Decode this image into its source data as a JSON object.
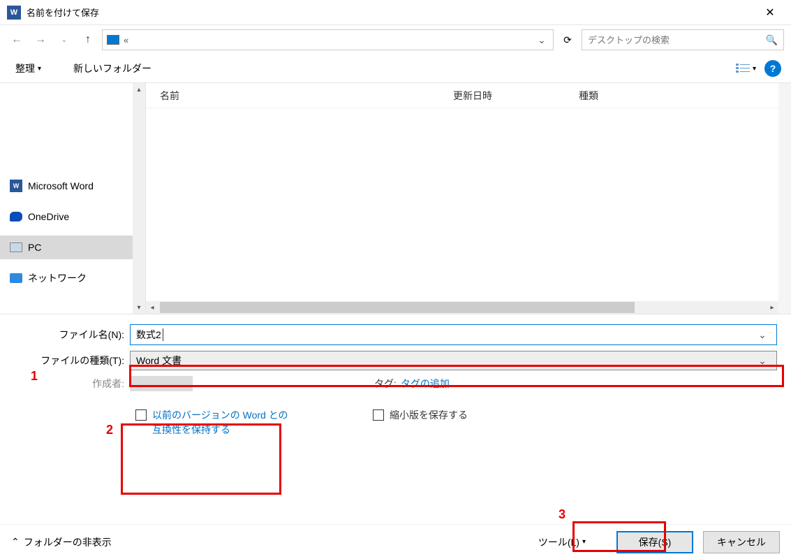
{
  "title": "名前を付けて保存",
  "nav": {
    "address": "«",
    "search_placeholder": "デスクトップの検索"
  },
  "toolbar": {
    "organize": "整理",
    "new_folder": "新しいフォルダー"
  },
  "columns": {
    "name": "名前",
    "date": "更新日時",
    "type": "種類"
  },
  "sidebar": {
    "items": [
      {
        "label": "Microsoft Word",
        "icon": "word"
      },
      {
        "label": "OneDrive",
        "icon": "onedrive"
      },
      {
        "label": "PC",
        "icon": "pc"
      },
      {
        "label": "ネットワーク",
        "icon": "network"
      }
    ]
  },
  "form": {
    "filename_label": "ファイル名(N):",
    "filename_value": "数式2",
    "filetype_label": "ファイルの種類(T):",
    "filetype_value": "Word 文書",
    "author_label": "作成者:",
    "tag_label": "タグ:",
    "tag_link": "タグの追加",
    "compat_label": "以前のバージョンの Word との互換性を保持する",
    "thumb_label": "縮小版を保存する"
  },
  "bottom": {
    "hide_folders": "フォルダーの非表示",
    "tools": "ツール(L)",
    "save": "保存(S)",
    "cancel": "キャンセル"
  },
  "annotations": {
    "n1": "1",
    "n2": "2",
    "n3": "3"
  }
}
